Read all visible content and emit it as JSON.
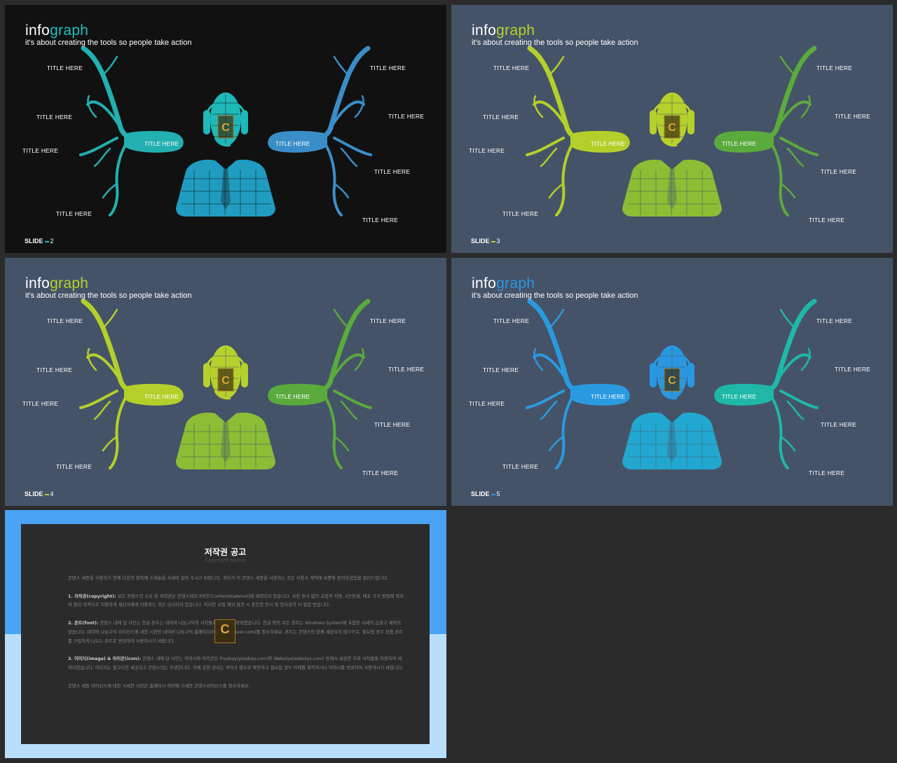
{
  "slides": [
    {
      "id": "slide-2",
      "bg": "#111111",
      "title_a": "info",
      "title_b": "graph",
      "subtitle": "it's about creating the tools so people take action",
      "accent_left": "#22b0b0",
      "accent_right": "#3a8ec8",
      "accent_person_top": "#1fb8b8",
      "accent_person_bottom": "#1f9cc0",
      "title_color": "#1ec0c0",
      "labels": [
        "TITLE HERE",
        "TITLE HERE",
        "TITLE HERE",
        "TITLE HERE",
        "TITLE HERE",
        "TITLE HERE",
        "TITLE HERE",
        "TITLE HERE"
      ],
      "pill_left": "TITLE HERE",
      "pill_right": "TITLE HERE",
      "slide_label": "SLIDE",
      "slide_number": "2",
      "dash_color": "#1ec0c0"
    },
    {
      "id": "slide-3",
      "bg": "#455368",
      "title_a": "info",
      "title_b": "graph",
      "subtitle": "it's about creating the tools so people take action",
      "accent_left": "#b4cf2a",
      "accent_right": "#5aaa3c",
      "accent_person_top": "#b6d12c",
      "accent_person_bottom": "#8cbd34",
      "title_color": "#b6d12c",
      "labels": [
        "TITLE HERE",
        "TITLE HERE",
        "TITLE HERE",
        "TITLE HERE",
        "TITLE HERE",
        "TITLE HERE",
        "TITLE HERE",
        "TITLE HERE"
      ],
      "pill_left": "TITLE HERE",
      "pill_right": "TITLE HERE",
      "slide_label": "SLIDE",
      "slide_number": "3",
      "dash_color": "#b6d12c"
    },
    {
      "id": "slide-4",
      "bg": "#455368",
      "title_a": "info",
      "title_b": "graph",
      "subtitle": "it's about creating the tools so people take action",
      "accent_left": "#b4cf2a",
      "accent_right": "#5aaa3c",
      "accent_person_top": "#b6d12c",
      "accent_person_bottom": "#8cbd34",
      "title_color": "#b6d12c",
      "labels": [
        "TITLE HERE",
        "TITLE HERE",
        "TITLE HERE",
        "TITLE HERE",
        "TITLE HERE",
        "TITLE HERE",
        "TITLE HERE",
        "TITLE HERE"
      ],
      "pill_left": "TITLE HERE",
      "pill_right": "TITLE HERE",
      "slide_label": "SLIDE",
      "slide_number": "4",
      "dash_color": "#b6d12c"
    },
    {
      "id": "slide-5",
      "bg": "#455368",
      "title_a": "info",
      "title_b": "graph",
      "subtitle": "it's about creating the tools so people take action",
      "accent_left": "#2a9ae0",
      "accent_right": "#1fb8a8",
      "accent_person_top": "#2a98e0",
      "accent_person_bottom": "#22a8d0",
      "title_color": "#2a98e0",
      "labels": [
        "TITLE HERE",
        "TITLE HERE",
        "TITLE HERE",
        "TITLE HERE",
        "TITLE HERE",
        "TITLE HERE",
        "TITLE HERE",
        "TITLE HERE"
      ],
      "pill_left": "TITLE HERE",
      "pill_right": "TITLE HERE",
      "slide_label": "SLIDE",
      "slide_number": "5",
      "dash_color": "#2a98e0"
    }
  ],
  "notice": {
    "title": "저작권 공고",
    "subtitle": "Copyright Notice",
    "intro": "콘텐스 세종을 사용하기 전에 다음의 항목에 소해놓을 사세이 일어 주시기 바랍니다. 귀하가 이 콘텐스 세종을 사용하는 것은 사용사 계약에 보증에 동의하셨음을 알려드립니다.",
    "p1_head": "1. 저작권(copyright):",
    "p1": " 보든 콘텐스의 소유 및 저작권은 콘텐스테이크아웃(Contentstakeout)에 세작되어 있습니다. 사전 승닉 없이 교립적 이용, 2단전세, 배포 가기 방법에 의하여 영리 목적으로 이용하게 세신사에게 이용하는 것은 금시되어 있습니다. 이러한 교립 해위 발견 시 준인한 민시 및 형사심의 시 발입 받습니다.",
    "p2_head": "2. 폰트(font):",
    "p2": " 콘텐스 내에 답 사인는 한글 폰트는 네이버 나눔고딕의 서작물로 쿠사이 세작되었습니다. 한글 외의 보든 폰트는 Windows System에 포함된 시세의 급권고 세작되었습니다. 네이버 나눔고딕 라이신스에 대한 시한인 네이버 나눔고딕 홈페이지(hangeul.naver.com)를 참소하세요. 폰트는 콘텐스의 함께 세공되지 않으므로, 필요업 경우 정품 폰트를 구입하게 나오는 폰트로 변경하여 사용하시기 바랍니다.",
    "p3_head": "3. 이미지(image) & 아이콘(icon):",
    "p3": " 콘텐스 내에 답 사인는 이미시와 아이콘은 Pixabay(pixabay.com)와 Webolys(webolys.com) 등에서 세공한 무료 서작물을 이용하여 세작되었습니다. 이미지는 참고으만 세공되고 콘텐스의는 무관한니다. 이에 관한 권리는 귀하가 별도로 확인하고 필요업 경우 이에를 취득하거나 이미시를 변경하여 사용하시기 바랍니다.",
    "outro": "콘텐스 세종 라이신스에 대한 시세한 사한은 홈페이시 하단에 기세한 콘텐스라이신스를 참소하세요.",
    "band_top": "#4aa3f5",
    "band_bottom": "#b9defc"
  }
}
